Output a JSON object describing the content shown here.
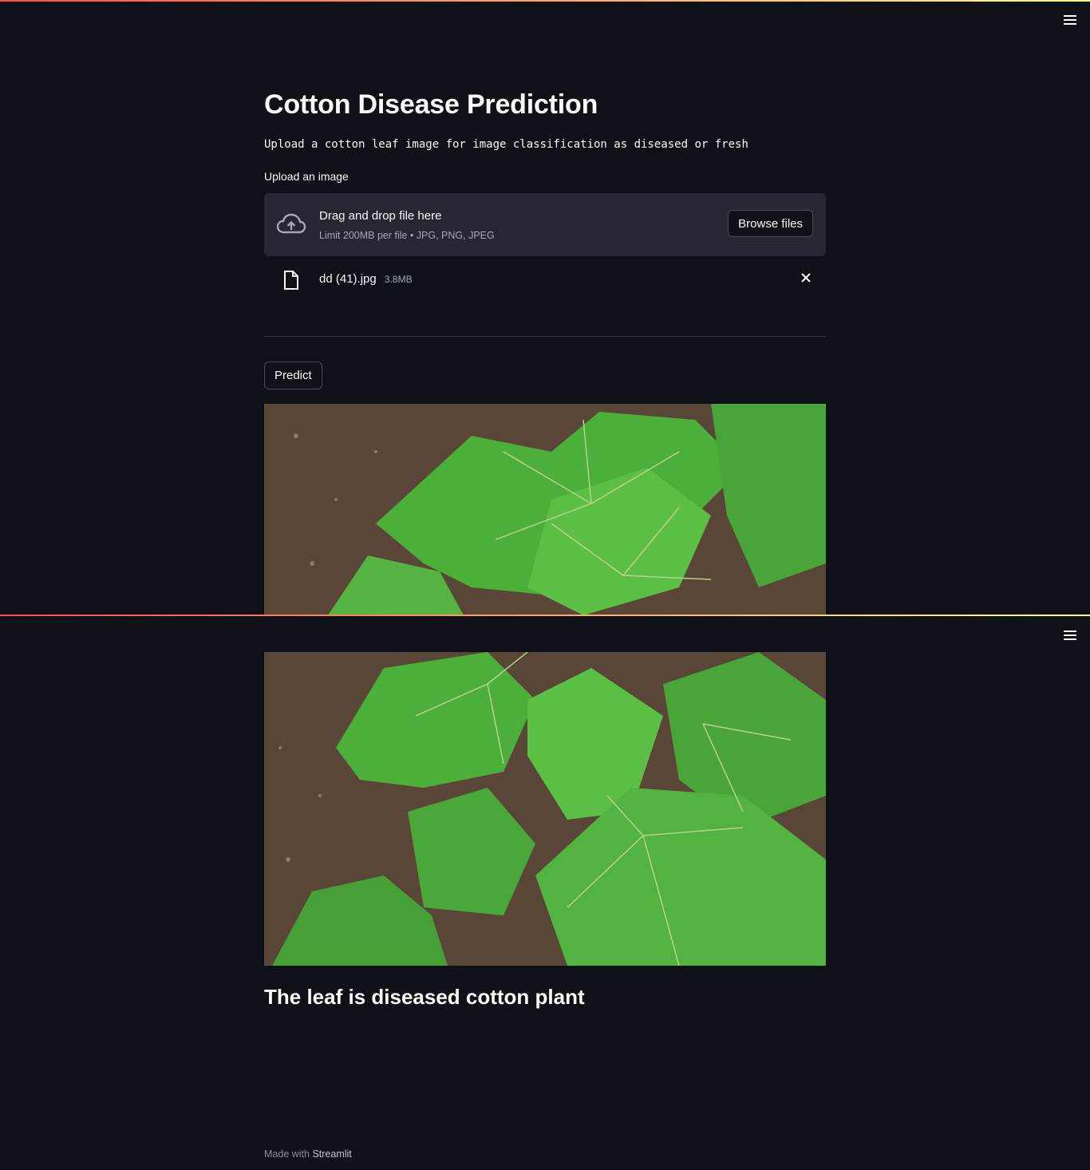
{
  "app": {
    "title": "Cotton Disease Prediction",
    "subtitle": "Upload a cotton leaf image for image classification as diseased or fresh"
  },
  "uploader": {
    "label": "Upload an image",
    "drop_title": "Drag and drop file here",
    "drop_limit": "Limit 200MB per file • JPG, PNG, JPEG",
    "browse_label": "Browse files",
    "icon": "cloud-upload-icon"
  },
  "uploaded_file": {
    "name": "dd (41).jpg",
    "size": "3.8MB",
    "icon": "file-icon"
  },
  "predict_label": "Predict",
  "result": "The leaf is diseased cotton plant",
  "footer": {
    "prefix": "Made with ",
    "brand": "Streamlit"
  },
  "colors": {
    "background": "#0e1117",
    "dropzone": "#262730",
    "accent_start": "#ff4b4b",
    "accent_end": "#fffd80",
    "leaf": "#4caf3a",
    "soil": "#5a4636"
  }
}
